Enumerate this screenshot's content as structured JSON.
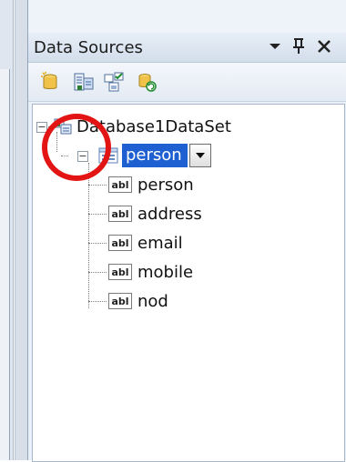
{
  "panel": {
    "title": "Data Sources",
    "title_buttons": [
      {
        "icon": "dropdown-arrow-icon"
      },
      {
        "icon": "pin-icon"
      },
      {
        "icon": "close-icon"
      }
    ]
  },
  "toolbar": {
    "buttons": [
      {
        "icon": "add-data-source-icon"
      },
      {
        "icon": "edit-dataset-designer-icon"
      },
      {
        "icon": "configure-dataset-wizard-icon"
      },
      {
        "icon": "refresh-icon"
      }
    ]
  },
  "tree": {
    "root": {
      "label": "Database1DataSet"
    },
    "table": {
      "label": "person"
    },
    "fields": [
      {
        "badge": "abl",
        "label": "person"
      },
      {
        "badge": "abl",
        "label": "address"
      },
      {
        "badge": "abl",
        "label": "email"
      },
      {
        "badge": "abl",
        "label": "mobile"
      },
      {
        "badge": "abl",
        "label": "nod"
      }
    ]
  },
  "colors": {
    "selection": "#1e5fd2",
    "highlight_circle": "#e31414"
  }
}
